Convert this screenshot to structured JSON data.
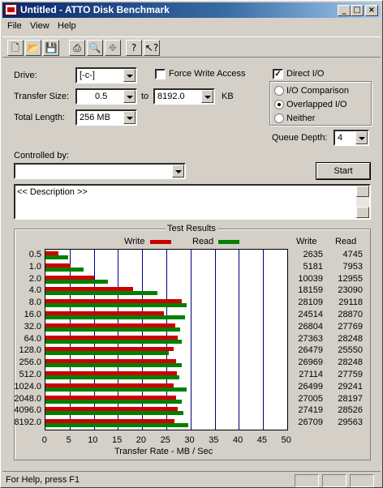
{
  "window": {
    "title": "Untitled - ATTO Disk Benchmark"
  },
  "menu": [
    "File",
    "View",
    "Help"
  ],
  "toolbar_icons": [
    "new-icon",
    "open-icon",
    "save-icon",
    "print-icon",
    "print-preview-icon",
    "move-icon",
    "help-icon",
    "context-help-icon"
  ],
  "form": {
    "drive_label": "Drive:",
    "drive_value": "[-c-]",
    "force_write_label": "Force Write Access",
    "direct_io_label": "Direct I/O",
    "transfer_size_label": "Transfer Size:",
    "transfer_from": "0.5",
    "to_label": "to",
    "transfer_to": "8192.0",
    "kb_label": "KB",
    "total_length_label": "Total Length:",
    "total_length": "256 MB",
    "io_comparison": "I/O Comparison",
    "overlapped_io": "Overlapped I/O",
    "neither": "Neither",
    "queue_depth_label": "Queue Depth:",
    "queue_depth": "4",
    "controlled_by_label": "Controlled by:",
    "start_label": "Start",
    "description": "<< Description >>"
  },
  "results": {
    "title": "Test Results",
    "write_legend": "Write",
    "read_legend": "Read",
    "write_col": "Write",
    "read_col": "Read",
    "xlabel": "Transfer Rate - MB / Sec"
  },
  "status": {
    "text": "For Help, press F1"
  },
  "colors": {
    "write": "#cc0000",
    "read": "#008000",
    "grid": "#000080"
  },
  "chart_data": {
    "type": "bar",
    "categories": [
      "0.5",
      "1.0",
      "2.0",
      "4.0",
      "8.0",
      "16.0",
      "32.0",
      "64.0",
      "128.0",
      "256.0",
      "512.0",
      "1024.0",
      "2048.0",
      "4096.0",
      "8192.0"
    ],
    "series": [
      {
        "name": "Write",
        "values": [
          2635,
          5181,
          10039,
          18159,
          28109,
          24514,
          26804,
          27363,
          26479,
          26969,
          27114,
          26499,
          27005,
          27419,
          26709
        ]
      },
      {
        "name": "Read",
        "values": [
          4745,
          7953,
          12955,
          23090,
          29118,
          28870,
          27769,
          28248,
          25550,
          28248,
          27759,
          29241,
          28197,
          28526,
          29563
        ]
      }
    ],
    "xticks": [
      "0",
      "5",
      "10",
      "15",
      "20",
      "25",
      "30",
      "35",
      "40",
      "45",
      "50"
    ],
    "xlim": [
      0,
      50
    ],
    "xlabel": "Transfer Rate - MB / Sec",
    "legend": "top"
  }
}
